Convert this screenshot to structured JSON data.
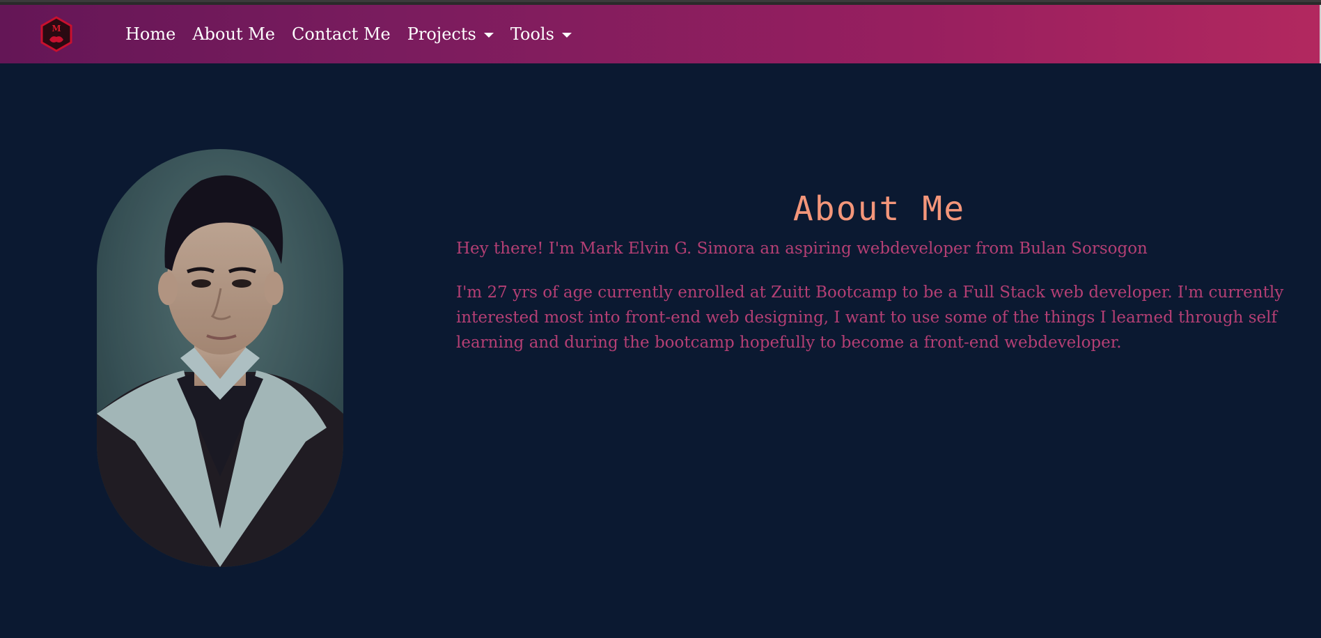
{
  "nav": {
    "brand_icon": "hexagon-logo-icon",
    "links": [
      {
        "label": "Home"
      },
      {
        "label": "About Me"
      },
      {
        "label": "Contact Me"
      },
      {
        "label": "Projects",
        "dropdown": true
      },
      {
        "label": "Tools",
        "dropdown": true
      }
    ]
  },
  "main": {
    "title": "About Me",
    "intro": "Hey there! I'm Mark Elvin G. Simora an aspiring webdeveloper from Bulan Sorsogon",
    "bio": "I'm 27 yrs of age currently enrolled at Zuitt Bootcamp to be a Full Stack web developer. I'm currently interested most into front-end web designing, I want to use some of the things I learned through self learning and during the bootcamp hopefully to become a front-end webdeveloper."
  },
  "colors": {
    "background": "#0b1931",
    "navbar_gradient_start": "#641656",
    "navbar_gradient_end": "#b2285f",
    "title": "#f4967a",
    "body_text": "#b43f74"
  }
}
